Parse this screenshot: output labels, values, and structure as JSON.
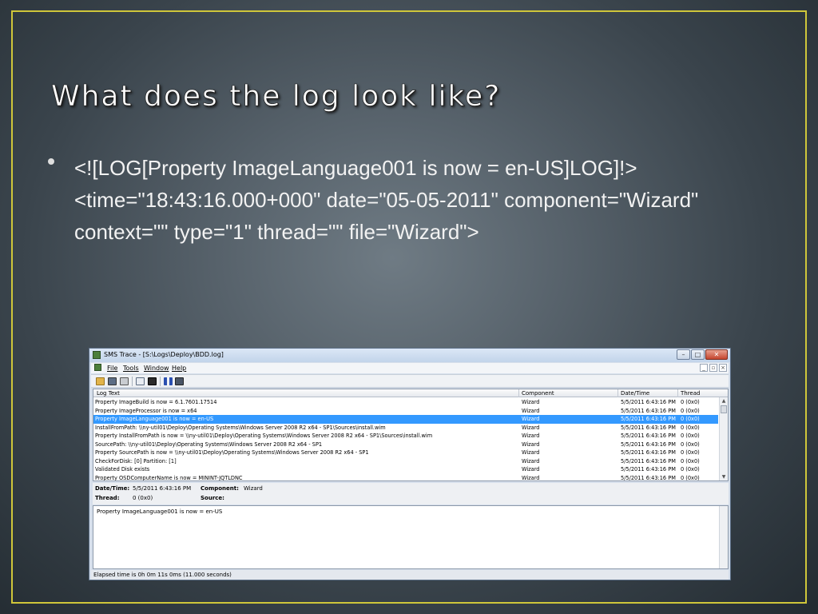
{
  "slide": {
    "title": "What does the log look like?",
    "bullet": "<![LOG[Property ImageLanguage001 is now = en-US]LOG]!><time=\"18:43:16.000+000\" date=\"05-05-2011\" component=\"Wizard\" context=\"\" type=\"1\" thread=\"\" file=\"Wizard\">"
  },
  "window": {
    "title": "SMS Trace - [S:\\Logs\\Deploy\\BDD.log]",
    "menu": {
      "file": "File",
      "tools": "Tools",
      "window": "Window",
      "help": "Help"
    },
    "columns": {
      "log_text": "Log Text",
      "component": "Component",
      "datetime": "Date/Time",
      "thread": "Thread"
    },
    "rows": [
      {
        "text": "Property ImageBuild is now = 6.1.7601.17514",
        "component": "Wizard",
        "datetime": "5/5/2011 6:43:16 PM",
        "thread": "0 (0x0)"
      },
      {
        "text": "Property ImageProcessor is now = x64",
        "component": "Wizard",
        "datetime": "5/5/2011 6:43:16 PM",
        "thread": "0 (0x0)"
      },
      {
        "text": "Property ImageLanguage001 is now = en-US",
        "component": "Wizard",
        "datetime": "5/5/2011 6:43:16 PM",
        "thread": "0 (0x0)"
      },
      {
        "text": "InstallFromPath: \\\\ny-util01\\Deploy\\Operating Systems\\Windows Server 2008 R2 x64 - SP1\\Sources\\install.wim",
        "component": "Wizard",
        "datetime": "5/5/2011 6:43:16 PM",
        "thread": "0 (0x0)"
      },
      {
        "text": "Property InstallFromPath is now = \\\\ny-util01\\Deploy\\Operating Systems\\Windows Server 2008 R2 x64 - SP1\\Sources\\install.wim",
        "component": "Wizard",
        "datetime": "5/5/2011 6:43:16 PM",
        "thread": "0 (0x0)"
      },
      {
        "text": "SourcePath: \\\\ny-util01\\Deploy\\Operating Systems\\Windows Server 2008 R2 x64 - SP1",
        "component": "Wizard",
        "datetime": "5/5/2011 6:43:16 PM",
        "thread": "0 (0x0)"
      },
      {
        "text": "Property SourcePath is now = \\\\ny-util01\\Deploy\\Operating Systems\\Windows Server 2008 R2 x64 - SP1",
        "component": "Wizard",
        "datetime": "5/5/2011 6:43:16 PM",
        "thread": "0 (0x0)"
      },
      {
        "text": "CheckForDisk: [0]  Partition: [1]",
        "component": "Wizard",
        "datetime": "5/5/2011 6:43:16 PM",
        "thread": "0 (0x0)"
      },
      {
        "text": "Validated Disk exists",
        "component": "Wizard",
        "datetime": "5/5/2011 6:43:16 PM",
        "thread": "0 (0x0)"
      },
      {
        "text": "Property OSDComputerName is now = MININT-JQTLDNC",
        "component": "Wizard",
        "datetime": "5/5/2011 6:43:16 PM",
        "thread": "0 (0x0)"
      }
    ],
    "selected_row": 2,
    "details": {
      "datetime_label": "Date/Time:",
      "datetime_value": "5/5/2011 6:43:16 PM",
      "component_label": "Component:",
      "component_value": "Wizard",
      "thread_label": "Thread:",
      "thread_value": "0 (0x0)",
      "source_label": "Source:",
      "source_value": ""
    },
    "message": "Property ImageLanguage001 is now = en-US",
    "status": "Elapsed time is 0h 0m 11s 0ms (11.000 seconds)"
  },
  "colors": {
    "frame": "#cfc63a",
    "selection": "#3399ff"
  }
}
